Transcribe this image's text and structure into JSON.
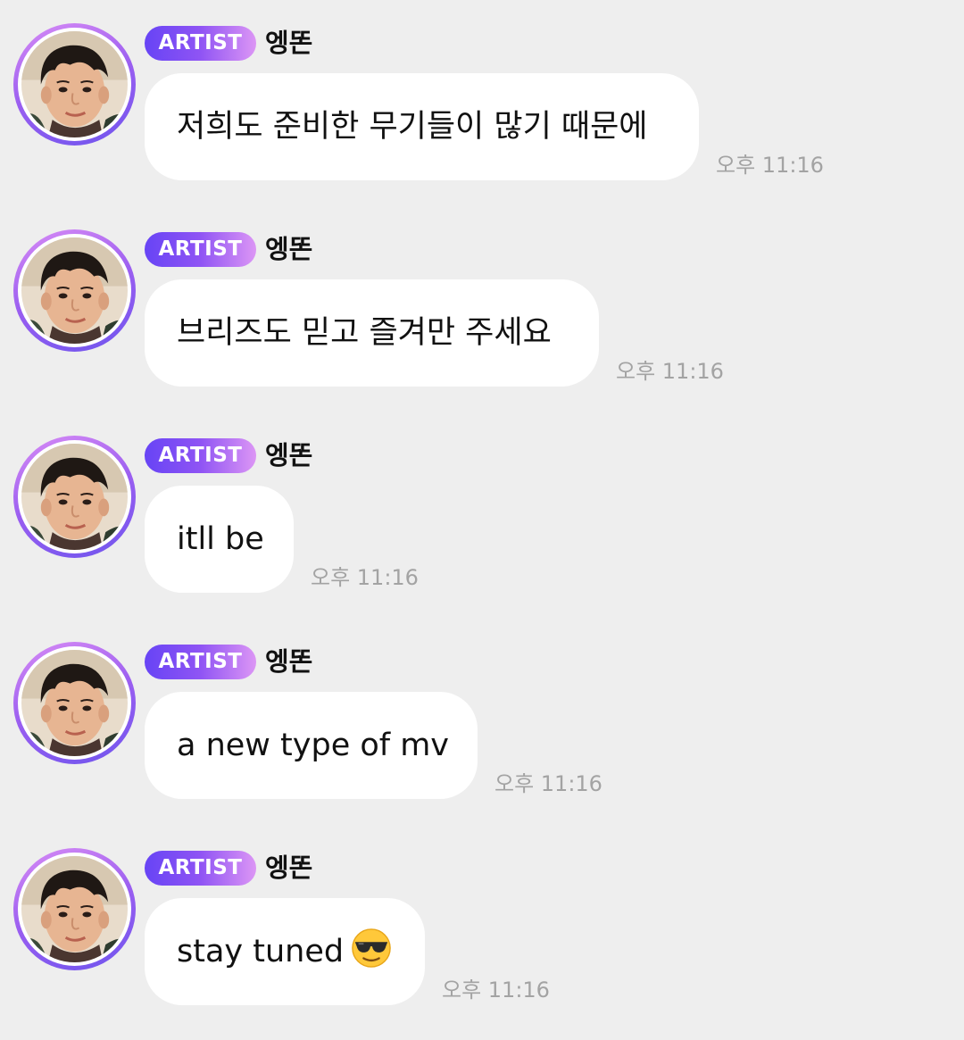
{
  "messages": [
    {
      "badge": "ARTIST",
      "sender": "엥똔",
      "text": "저희도 준비한 무기들이 많기 때문에",
      "time": "오후 11:16",
      "avatar_icon": "profile-photo-boy"
    },
    {
      "badge": "ARTIST",
      "sender": "엥똔",
      "text": "브리즈도 믿고 즐겨만 주세요",
      "time": "오후 11:16",
      "avatar_icon": "profile-photo-boy"
    },
    {
      "badge": "ARTIST",
      "sender": "엥똔",
      "text": "itll be",
      "time": "오후 11:16",
      "avatar_icon": "profile-photo-boy"
    },
    {
      "badge": "ARTIST",
      "sender": "엥똔",
      "text": "a new type of mv",
      "time": "오후 11:16",
      "avatar_icon": "profile-photo-boy"
    },
    {
      "badge": "ARTIST",
      "sender": "엥똔",
      "text": "stay tuned",
      "emoji": "smiling-face-with-sunglasses-emoji",
      "time": "오후 11:16",
      "avatar_icon": "profile-photo-boy"
    }
  ],
  "colors": {
    "background": "#eeeeee",
    "bubble": "#ffffff",
    "badge_gradient_start": "#6744f5",
    "badge_gradient_end": "#dc96f5",
    "timestamp": "#a3a3a3"
  }
}
